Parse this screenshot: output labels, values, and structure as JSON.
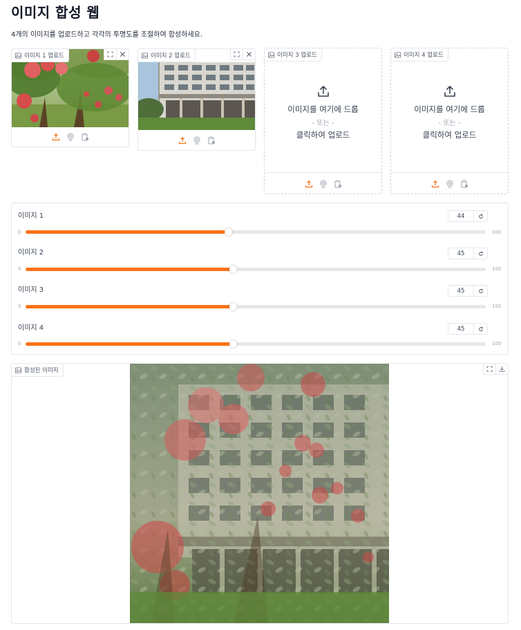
{
  "header": {
    "title": "이미지 합성 웹",
    "subtitle": "4개의 이미지를 업로드하고 각각의 투명도를 조절하여 합성하세요."
  },
  "uploads": [
    {
      "label": "이미지 1 업로드",
      "has_image": true,
      "image_desc": "apple orchard"
    },
    {
      "label": "이미지 2 업로드",
      "has_image": true,
      "image_desc": "building"
    },
    {
      "label": "이미지 3 업로드",
      "has_image": false
    },
    {
      "label": "이미지 4 업로드",
      "has_image": false
    }
  ],
  "dropzone": {
    "text": "이미지를 여기에 드롭",
    "or": "- 또는 -",
    "click": "클릭하여 업로드"
  },
  "sliders": [
    {
      "label": "이미지 1",
      "value": 44,
      "min": 0,
      "max": 100
    },
    {
      "label": "이미지 2",
      "value": 45,
      "min": 0,
      "max": 100
    },
    {
      "label": "이미지 3",
      "value": 45,
      "min": 0,
      "max": 100
    },
    {
      "label": "이미지 4",
      "value": 45,
      "min": 0,
      "max": 100
    }
  ],
  "output": {
    "label": "합성된 이미지"
  },
  "colors": {
    "accent": "#f97316",
    "border": "#e5e7eb"
  },
  "icons": [
    "image-icon",
    "fullscreen-icon",
    "close-icon",
    "upload-icon",
    "webcam-icon",
    "clipboard-icon",
    "reset-icon",
    "download-icon"
  ]
}
